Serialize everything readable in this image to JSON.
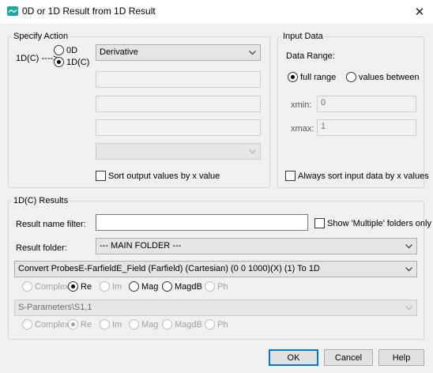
{
  "window": {
    "title": "0D or 1D Result from 1D Result",
    "close_glyph": "✕",
    "icon": "result-app-icon"
  },
  "specify_action": {
    "legend": "Specify Action",
    "source_label": "1D(C) ---->",
    "radio_0d": "0D",
    "radio_1dc": "1D(C)",
    "selected": "1D(C)",
    "operation": "Derivative",
    "field1": "",
    "field2": "",
    "field3": "",
    "dropdown2": "",
    "sort_checkbox": "Sort output values by x value",
    "sort_checked": false
  },
  "input_data": {
    "legend": "Input Data",
    "data_range_label": "Data Range:",
    "full_range": "full range",
    "values_between": "values between",
    "selected": "full range",
    "xmin_label": "xmin:",
    "xmin_value": "0",
    "xmax_label": "xmax:",
    "xmax_value": "1",
    "always_sort": "Always sort input data by x values",
    "always_sort_checked": false
  },
  "results": {
    "legend": "1D(C) Results",
    "filter_label": "Result name filter:",
    "filter_value": "",
    "show_multiple": "Show 'Multiple' folders only",
    "show_multiple_checked": false,
    "folder_label": "Result folder:",
    "folder_value": "--- MAIN FOLDER ---",
    "result1_value": "Convert ProbesE-FarfieldE_Field (Farfield) (Cartesian) (0 0 1000)(X) (1) To 1D",
    "result1_options": [
      "Complex",
      "Re",
      "Im",
      "Mag",
      "MagdB",
      "Ph"
    ],
    "result1_selected": "Re",
    "result2_value": "S-Parameters\\S1,1",
    "result2_options": [
      "Complex",
      "Re",
      "Im",
      "Mag",
      "MagdB",
      "Ph"
    ],
    "result2_selected": "Re"
  },
  "buttons": {
    "ok": "OK",
    "cancel": "Cancel",
    "help": "Help"
  }
}
